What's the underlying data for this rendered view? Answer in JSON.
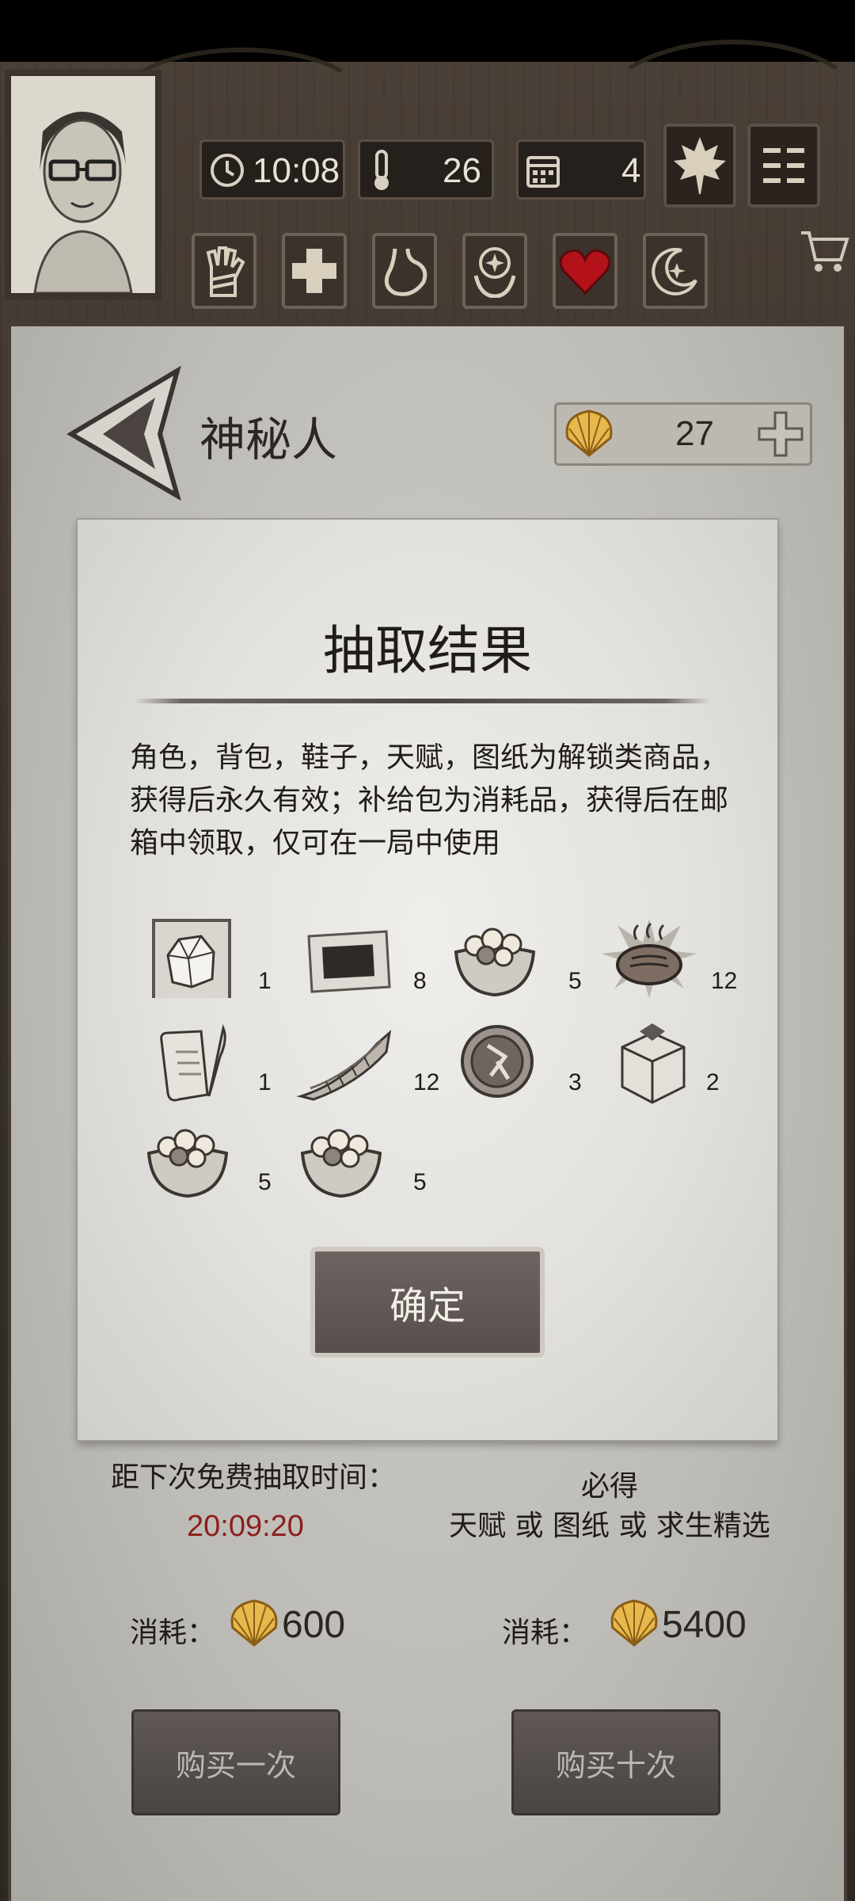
{
  "hud": {
    "time": "10:08",
    "temperature": "26",
    "day": "4"
  },
  "header": {
    "title": "神秘人",
    "shell_amount": "27"
  },
  "modal": {
    "title": "抽取结果",
    "description": "角色，背包，鞋子，天赋，图纸为解锁类商品，获得后永久有效；补给包为消耗品，获得后在邮箱中领取，仅可在一局中使用",
    "items": [
      {
        "icon": "ore-rock-icon",
        "count": "1"
      },
      {
        "icon": "blueprint-slab-icon",
        "count": "8"
      },
      {
        "icon": "supply-bowl-icon",
        "count": "5"
      },
      {
        "icon": "grilled-steak-icon",
        "count": "12"
      },
      {
        "icon": "scroll-quill-icon",
        "count": "1"
      },
      {
        "icon": "dried-fish-icon",
        "count": "12"
      },
      {
        "icon": "talent-coin-icon",
        "count": "3"
      },
      {
        "icon": "supply-box-icon",
        "count": "2"
      },
      {
        "icon": "supply-bowl-icon",
        "count": "5"
      },
      {
        "icon": "supply-bowl-icon",
        "count": "5"
      }
    ],
    "confirm_label": "确定"
  },
  "footer": {
    "free_label": "距下次免费抽取时间：",
    "timer": "20:09:20",
    "guarantee_line1": "必得",
    "guarantee_line2": "天赋 或 图纸 或 求生精选",
    "cost_label": "消耗：",
    "cost_single": "600",
    "cost_ten": "5400",
    "buy_once_label": "购买一次",
    "buy_ten_label": "购买十次"
  },
  "colors": {
    "timer": "#8c1e1e",
    "health_heart": "#b3121b",
    "shell": "#e7b94d"
  }
}
